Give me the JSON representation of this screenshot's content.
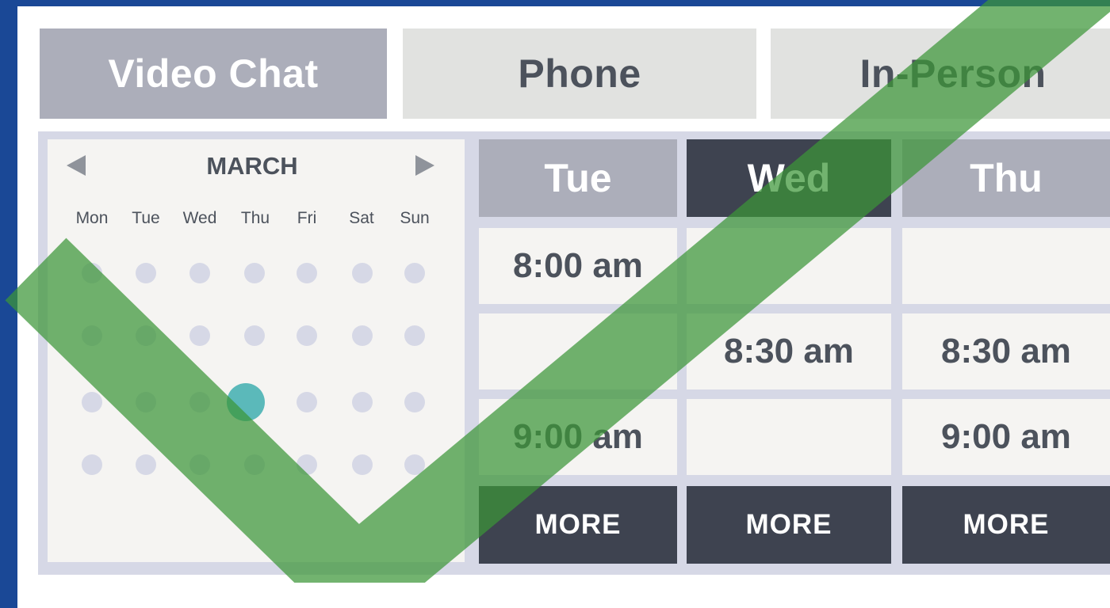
{
  "tabs": [
    {
      "label": "Video Chat",
      "active": true
    },
    {
      "label": "Phone",
      "active": false
    },
    {
      "label": "In-Person",
      "active": false
    }
  ],
  "calendar": {
    "month": "MARCH",
    "weekdays": [
      "Mon",
      "Tue",
      "Wed",
      "Thu",
      "Fri",
      "Sat",
      "Sun"
    ],
    "rows": 4,
    "selected": {
      "row": 2,
      "col": 3
    }
  },
  "days": [
    {
      "label": "Tue",
      "selected": false,
      "slots": [
        "8:00 am",
        "",
        "9:00 am"
      ],
      "more": "MORE"
    },
    {
      "label": "Wed",
      "selected": true,
      "slots": [
        "",
        "8:30 am",
        ""
      ],
      "more": "MORE"
    },
    {
      "label": "Thu",
      "selected": false,
      "slots": [
        "",
        "8:30 am",
        "9:00 am"
      ],
      "more": "MORE"
    }
  ],
  "colors": {
    "frame": "#1a4896",
    "tab_active": "#acaeba",
    "tab_inactive": "#e1e2e0",
    "day_header": "#acaeba",
    "day_header_selected": "#3e4350",
    "more_button": "#3e4350",
    "calendar_dot": "#d6d8e6",
    "calendar_selected": "#5bb9ba",
    "checkmark_overlay": "#3c9638"
  },
  "overlay": {
    "icon": "checkmark-icon"
  }
}
